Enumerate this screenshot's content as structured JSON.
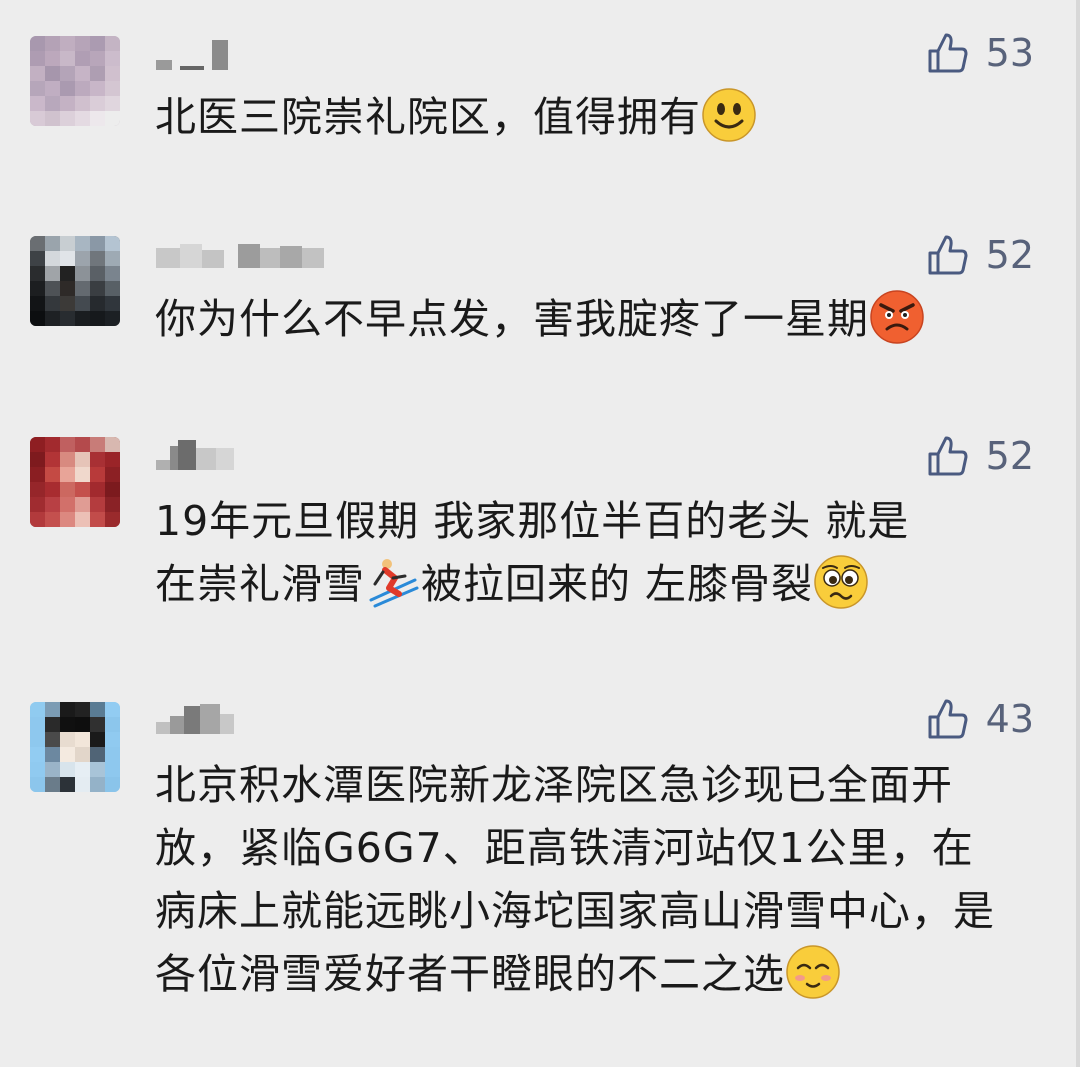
{
  "comments": [
    {
      "likes": "53",
      "text": "北医三院崇礼院区，值得拥有",
      "emoji": "smile-emoji"
    },
    {
      "likes": "52",
      "text": "你为什么不早点发，害我腚疼了一星期",
      "emoji": "angry-emoji"
    },
    {
      "likes": "52",
      "text_line1": "19年元旦假期 我家那位半百的老头 就是",
      "text_line2a": "在崇礼滑雪",
      "text_line2b": "被拉回来的  左膝骨裂",
      "emoji_mid": "skier-emoji",
      "emoji": "pleading-emoji"
    },
    {
      "likes": "43",
      "text": "北京积水潭医院新龙泽院区急诊现已全面开放，紧临G6G7、距高铁清河站仅1公里，在病床上就能远眺小海坨国家高山滑雪中心，是各位滑雪爱好者干瞪眼的不二之选",
      "emoji": "blush-emoji"
    }
  ]
}
